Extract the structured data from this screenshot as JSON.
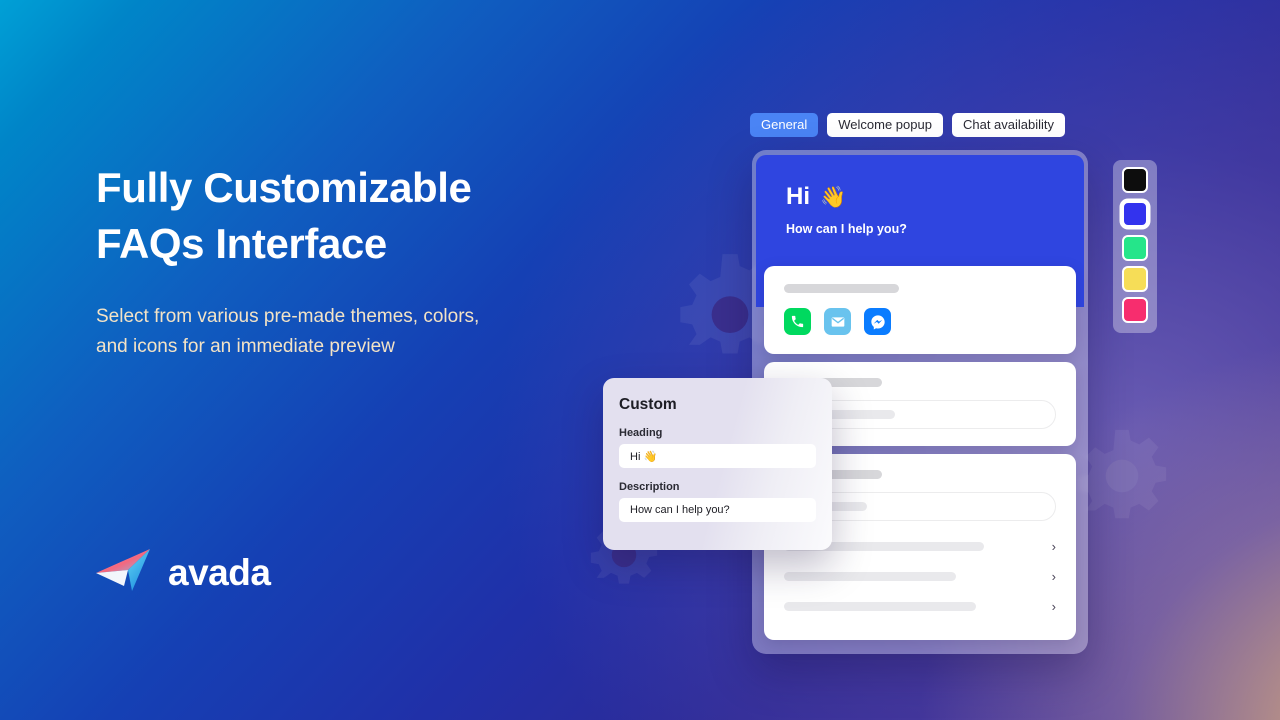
{
  "hero": {
    "headline_line1": "Fully Customizable",
    "headline_line2": "FAQs Interface",
    "subhead": "Select from various pre-made themes, colors, and icons for an immediate preview",
    "logo_word": "avada",
    "logo_icon": "avada-paper-plane-logo"
  },
  "tabs": [
    {
      "label": "General",
      "active": true
    },
    {
      "label": "Welcome popup",
      "active": false
    },
    {
      "label": "Chat availability",
      "active": false
    }
  ],
  "widget": {
    "header": {
      "title": "Hi",
      "wave_emoji": "👋",
      "subtitle": "How can I help you?",
      "background_color": "#2f45e0"
    },
    "contact_card": {
      "title_placeholder_bar": true,
      "icons": [
        {
          "name": "phone-icon",
          "color": "#00d95f",
          "glyph": "📞"
        },
        {
          "name": "email-icon",
          "color": "#69c3ee",
          "glyph": "✉"
        },
        {
          "name": "messenger-icon",
          "color": "#0a7cff",
          "glyph": "messenger"
        }
      ]
    },
    "faq_cards": [
      {
        "heading_bar": true,
        "search_pill": true,
        "rows": 0
      },
      {
        "heading_bar": true,
        "search_pill": true,
        "rows": 3,
        "chevron": "›"
      }
    ]
  },
  "swatches": [
    {
      "name": "swatch-black",
      "color": "#0d0d0d",
      "selected": false
    },
    {
      "name": "swatch-blue",
      "color": "#3333ee",
      "selected": true
    },
    {
      "name": "swatch-green",
      "color": "#25e58a",
      "selected": false
    },
    {
      "name": "swatch-yellow",
      "color": "#f6dd57",
      "selected": false
    },
    {
      "name": "swatch-pink",
      "color": "#f72d6e",
      "selected": false
    }
  ],
  "custom_panel": {
    "title": "Custom",
    "heading_label": "Heading",
    "heading_value": "Hi 👋",
    "description_label": "Description",
    "description_value": "How can I help you?"
  },
  "theme": {
    "accent_blue": "#4a84f5",
    "widget_blue": "#2f45e0",
    "subhead_cream": "#f3e3c6"
  }
}
